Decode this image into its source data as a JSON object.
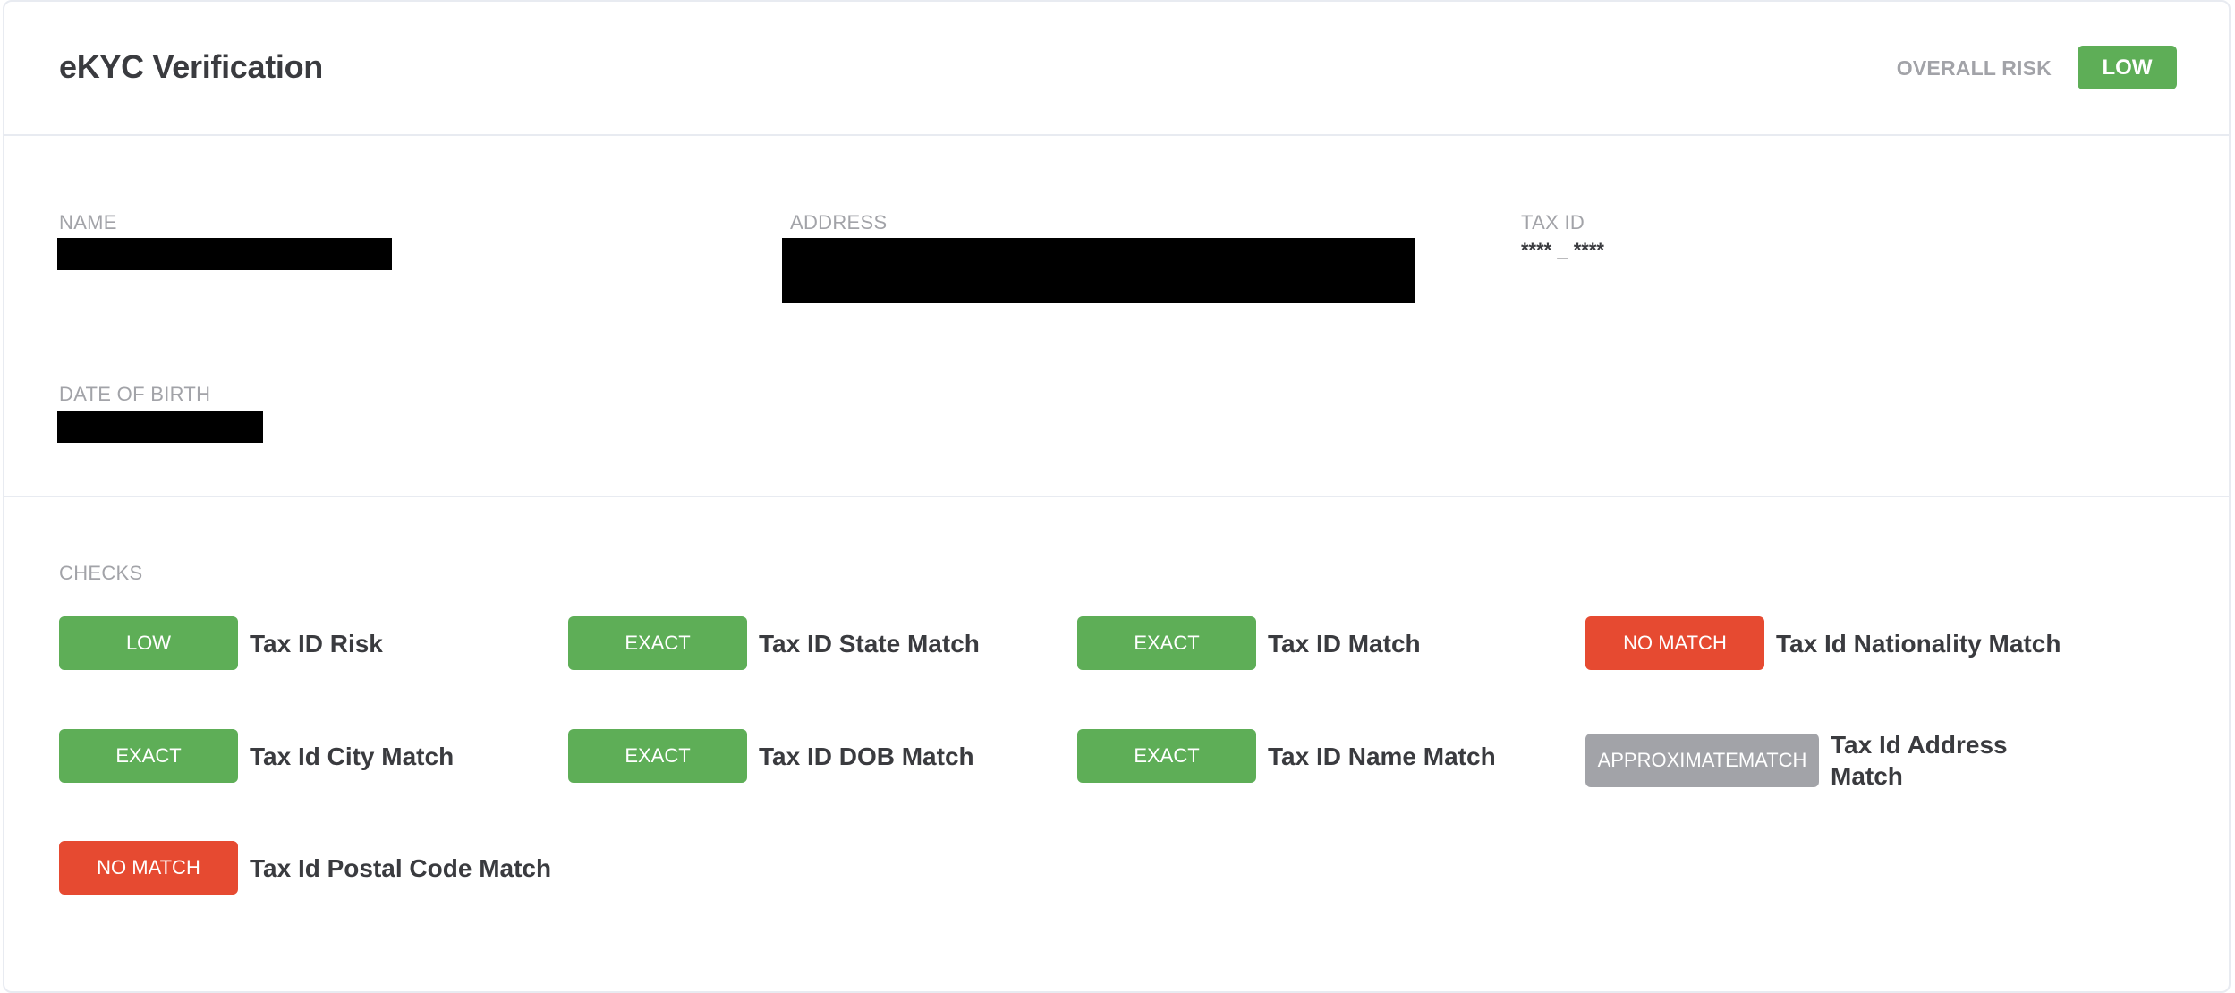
{
  "header": {
    "title": "eKYC Verification",
    "overall_risk_label": "OVERALL RISK",
    "overall_risk_value": "LOW"
  },
  "fields": {
    "name": {
      "label": "NAME",
      "value": "[redacted]"
    },
    "address": {
      "label": "ADDRESS",
      "value": "[redacted]"
    },
    "tax_id": {
      "label": "TAX ID",
      "value": "**** _ ****"
    },
    "dob": {
      "label": "DATE OF BIRTH",
      "value": "[redacted]"
    }
  },
  "checks": {
    "label": "CHECKS",
    "items": [
      {
        "status": "LOW",
        "label": "Tax ID Risk",
        "color": "#5eae57"
      },
      {
        "status": "EXACT",
        "label": "Tax ID State Match",
        "color": "#5eae57"
      },
      {
        "status": "EXACT",
        "label": "Tax ID Match",
        "color": "#5eae57"
      },
      {
        "status": "NO MATCH",
        "label": "Tax Id Nationality Match",
        "color": "#e64a31"
      },
      {
        "status": "EXACT",
        "label": "Tax Id City Match",
        "color": "#5eae57"
      },
      {
        "status": "EXACT",
        "label": "Tax ID DOB Match",
        "color": "#5eae57"
      },
      {
        "status": "EXACT",
        "label": "Tax ID Name Match",
        "color": "#5eae57"
      },
      {
        "status": "APPROXIMATEMATCH",
        "label": "Tax Id Address Match",
        "color": "#a2a3a8"
      },
      {
        "status": "NO MATCH",
        "label": "Tax Id Postal Code Match",
        "color": "#e64a31"
      }
    ]
  },
  "colors": {
    "success": "#5eae57",
    "danger": "#e64a31",
    "neutral": "#a2a3a8"
  }
}
